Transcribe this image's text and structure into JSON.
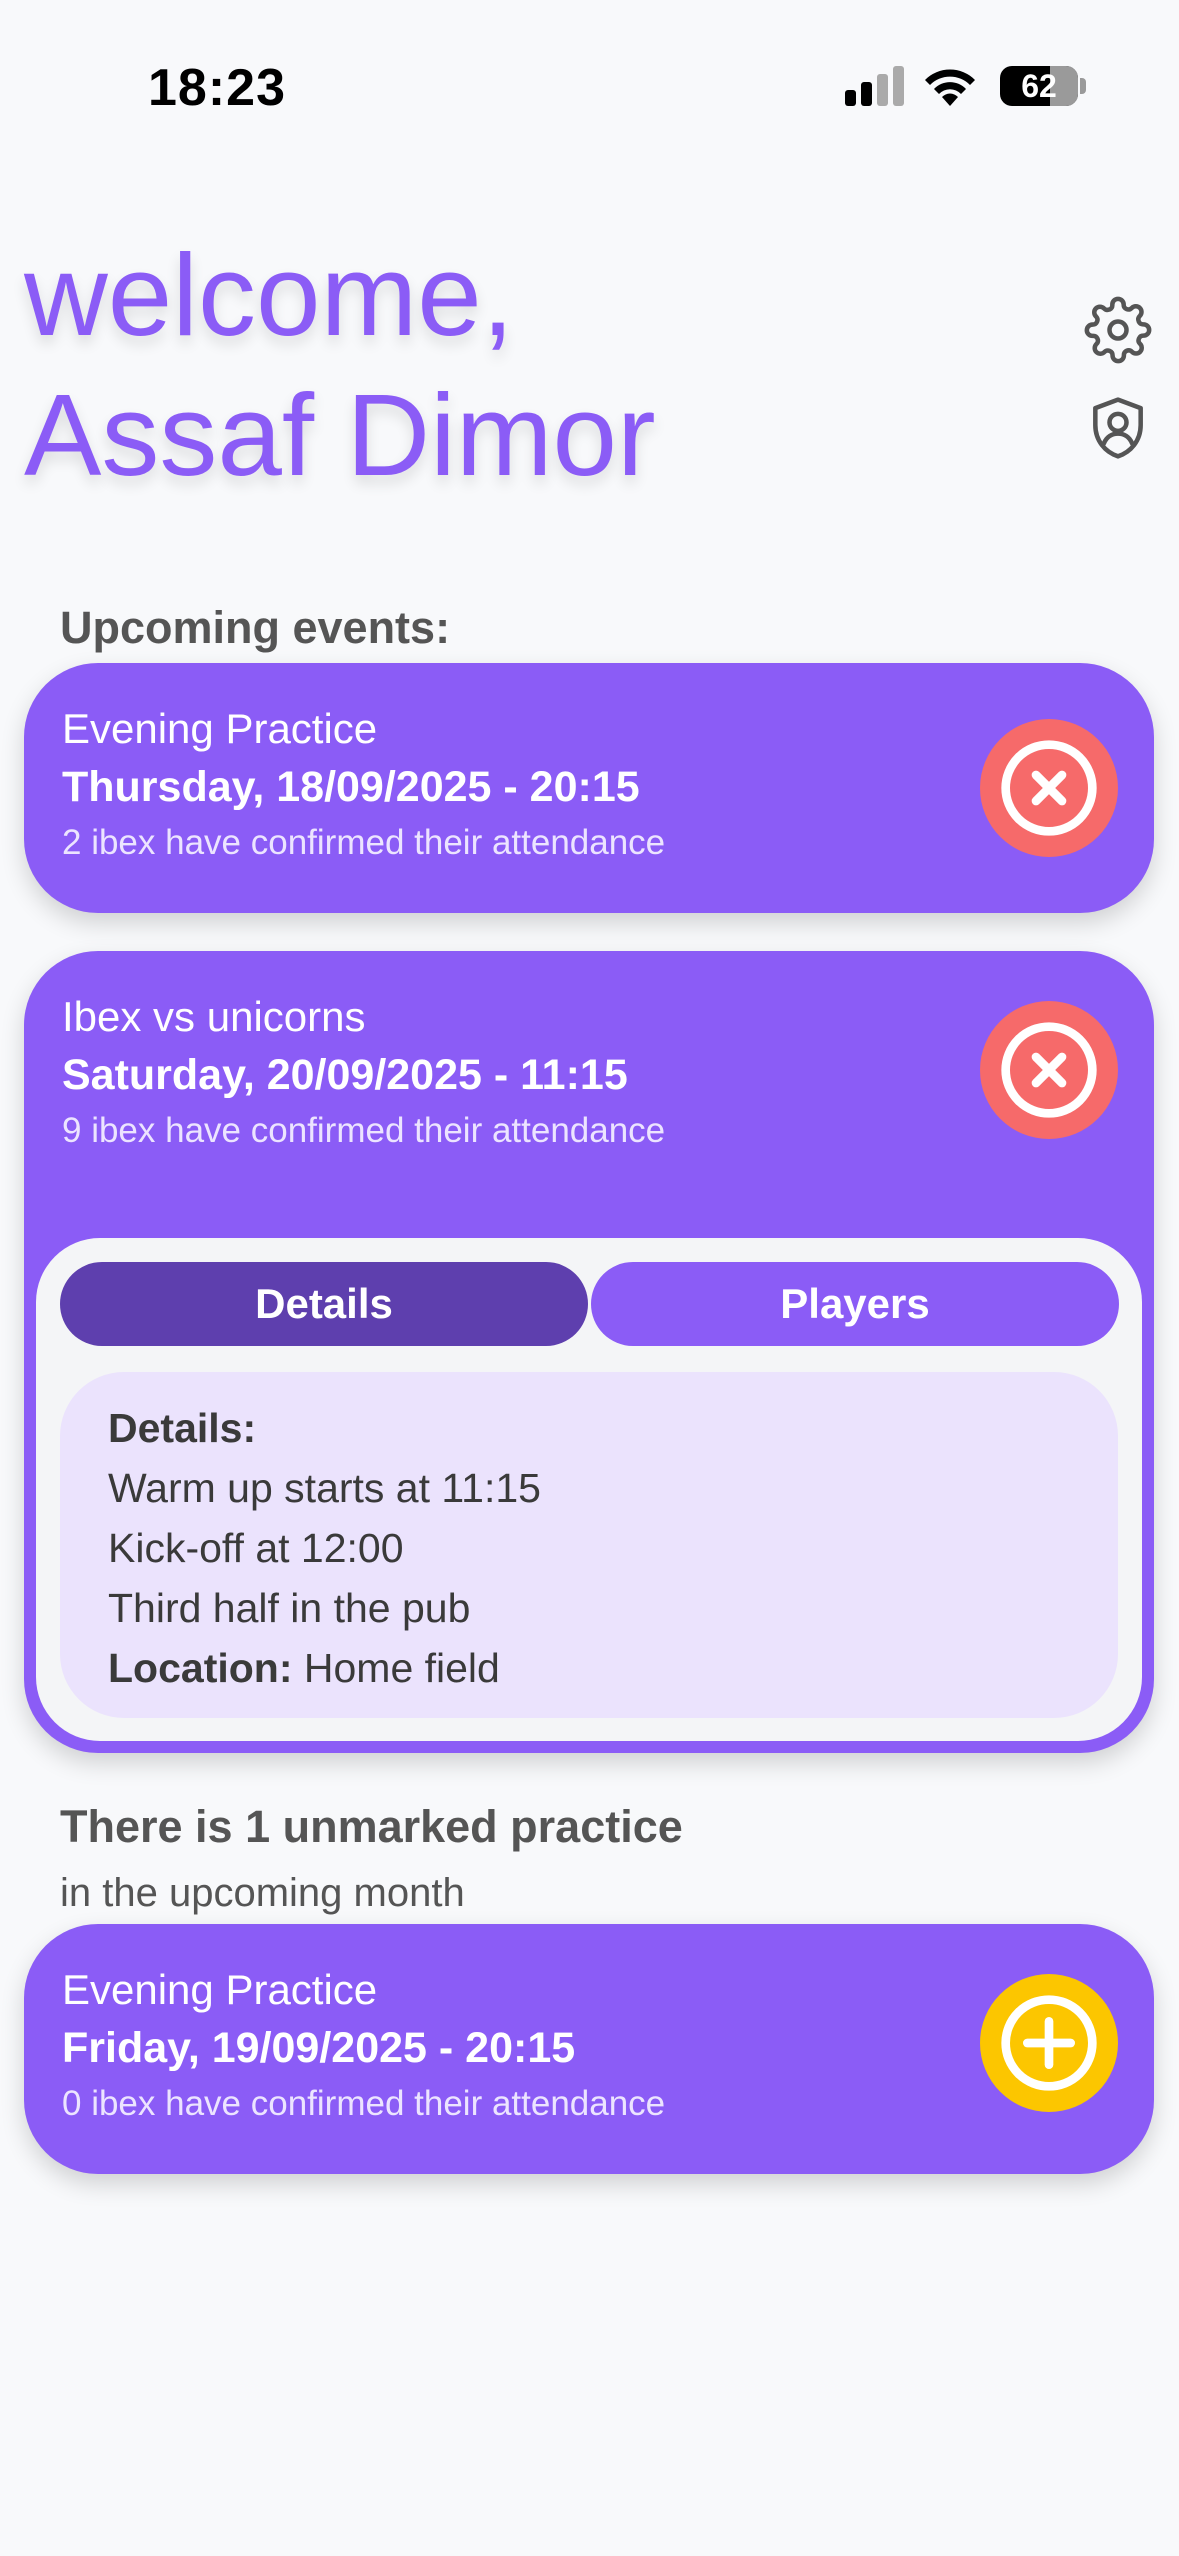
{
  "status_bar": {
    "time": "18:23",
    "battery": "62",
    "icons": [
      "signal-icon",
      "wifi-icon",
      "battery-icon"
    ]
  },
  "header": {
    "greeting": "welcome,",
    "user_name": "Assaf Dimor",
    "icons": [
      "settings-gear-icon",
      "admin-shield-icon"
    ]
  },
  "upcoming": {
    "label": "Upcoming events:",
    "events": [
      {
        "title": "Evening Practice",
        "date": "Thursday, 18/09/2025 - 20:15",
        "attendance": "2 ibex have confirmed their attendance",
        "action_icon": "cancel-x-icon"
      },
      {
        "title": "Ibex vs unicorns",
        "date": "Saturday, 20/09/2025 - 11:15",
        "attendance": "9 ibex have confirmed their attendance",
        "action_icon": "cancel-x-icon",
        "tabs": [
          "Details",
          "Players"
        ],
        "details": {
          "heading": "Details:",
          "lines": [
            "Warm up starts at 11:15",
            "Kick-off at 12:00",
            "Third half in the pub"
          ],
          "location_label": "Location:",
          "location_value": " Home field"
        }
      }
    ]
  },
  "unmarked": {
    "label": "There is 1 unmarked practice",
    "sublabel": "in the upcoming month",
    "events": [
      {
        "title": "Evening Practice",
        "date": "Friday, 19/09/2025 - 20:15",
        "attendance": "0 ibex have confirmed their attendance",
        "action_icon": "add-plus-icon"
      }
    ]
  },
  "colors": {
    "accent": "#8b5cf6",
    "accent_dark": "#5e3fae",
    "cancel": "#f66a6a",
    "add": "#fcc600",
    "details_bg": "#ebe3fd"
  }
}
